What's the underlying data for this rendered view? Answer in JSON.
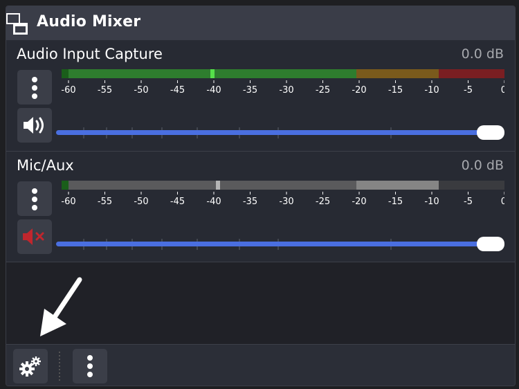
{
  "dock": {
    "title": "Audio Mixer",
    "icon": "window-icon"
  },
  "scale_ticks": [
    "-60",
    "-55",
    "-50",
    "-45",
    "-40",
    "-35",
    "-30",
    "-25",
    "-20",
    "-15",
    "-10",
    "-5",
    "0"
  ],
  "sources": [
    {
      "name": "Audio Input Capture",
      "db": "0.0 dB",
      "muted": false,
      "volume_level": 1.0,
      "peak_db": -40,
      "icons": {
        "menu": "three-dots-vertical-icon",
        "volume": "speaker-on-icon"
      },
      "colors": {
        "green": "#2e7d2e",
        "yellow": "#7a5a1c",
        "red": "#7a1e22",
        "peak": "#55e04a"
      }
    },
    {
      "name": "Mic/Aux",
      "db": "0.0 dB",
      "muted": true,
      "volume_level": 1.0,
      "peak_db": -40,
      "icons": {
        "menu": "three-dots-vertical-icon",
        "volume": "speaker-muted-icon"
      },
      "colors": {
        "green": "#5a5a5c",
        "yellow": "#858585",
        "red": "#3a3b3f",
        "peak": "#b5b5b5"
      }
    }
  ],
  "footer": {
    "icons": [
      "gear-icon",
      "three-dots-vertical-icon"
    ]
  },
  "annotation": {
    "icon": "arrow-pointer-icon"
  },
  "colors": {
    "accent": "#4a6fe0",
    "panel": "#272a33",
    "titlebar": "#3a3d48",
    "button": "#3b3e48"
  }
}
